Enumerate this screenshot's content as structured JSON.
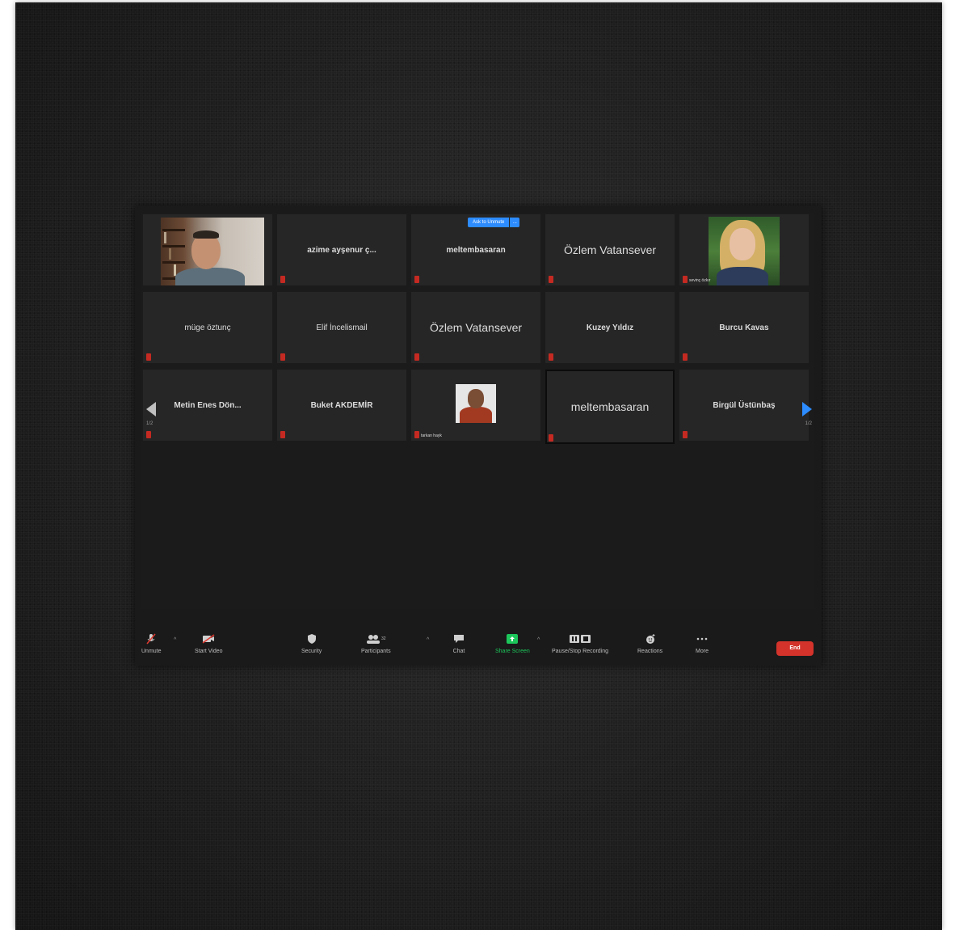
{
  "meeting": {
    "unmute_request": {
      "label": "Ask to Unmute",
      "more": "..."
    },
    "page_left": "1/2",
    "page_right": "1/2",
    "tiles": [
      {
        "id": "t1",
        "name": "",
        "video": "man-bookshelf"
      },
      {
        "id": "t2",
        "name": "azime ayşenur ç..."
      },
      {
        "id": "t3",
        "name": "meltembasaran"
      },
      {
        "id": "t4",
        "name": "Özlem Vatansever"
      },
      {
        "id": "t5",
        "name": "",
        "video": "woman-blonde",
        "label": "sevinç özkır"
      },
      {
        "id": "t6",
        "name": "müge öztunç"
      },
      {
        "id": "t7",
        "name": "Elif İncelismail"
      },
      {
        "id": "t8",
        "name": "Özlem Vatansever"
      },
      {
        "id": "t9",
        "name": "Kuzey Yıldız"
      },
      {
        "id": "t10",
        "name": "Burcu Kavas"
      },
      {
        "id": "t11",
        "name": "Metin Enes Dön..."
      },
      {
        "id": "t12",
        "name": "Buket AKDEMİR"
      },
      {
        "id": "t13",
        "name": "",
        "video": "avatar-man",
        "label": "tarkan hayk"
      },
      {
        "id": "t14",
        "name": "meltembasaran"
      },
      {
        "id": "t15",
        "name": "Birgül Üstünbaş"
      }
    ]
  },
  "toolbar": {
    "unmute": "Unmute",
    "start_video": "Start Video",
    "security": "Security",
    "participants": "Participants",
    "participants_count": "32",
    "chat": "Chat",
    "share_screen": "Share Screen",
    "recording": "Pause/Stop Recording",
    "reactions": "Reactions",
    "more": "More",
    "end": "End"
  },
  "colors": {
    "accent_blue": "#2d8cff",
    "end_red": "#d3332b",
    "share_green": "#1cc65a",
    "mute_red": "#c42a22"
  }
}
